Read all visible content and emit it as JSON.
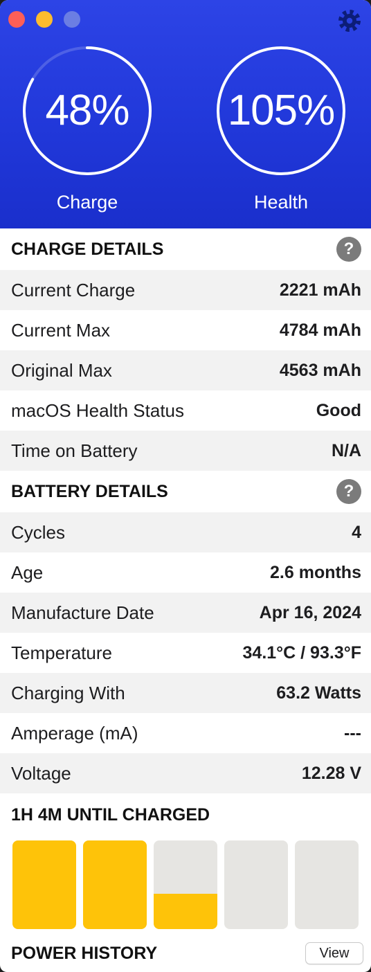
{
  "header": {
    "gauges": {
      "charge": {
        "value": "48%",
        "label": "Charge"
      },
      "health": {
        "value": "105%",
        "label": "Health"
      }
    }
  },
  "charge_details": {
    "heading": "CHARGE DETAILS",
    "help_label": "?",
    "rows": [
      {
        "label": "Current Charge",
        "value": "2221 mAh"
      },
      {
        "label": "Current Max",
        "value": "4784 mAh"
      },
      {
        "label": "Original Max",
        "value": "4563 mAh"
      },
      {
        "label": "macOS Health Status",
        "value": "Good"
      },
      {
        "label": "Time on Battery",
        "value": "N/A"
      }
    ]
  },
  "battery_details": {
    "heading": "BATTERY DETAILS",
    "help_label": "?",
    "rows": [
      {
        "label": "Cycles",
        "value": "4"
      },
      {
        "label": "Age",
        "value": "2.6 months"
      },
      {
        "label": "Manufacture Date",
        "value": "Apr 16, 2024"
      },
      {
        "label": "Temperature",
        "value": "34.1°C / 93.3°F"
      },
      {
        "label": "Charging With",
        "value": "63.2 Watts"
      },
      {
        "label": "Amperage (mA)",
        "value": "---"
      },
      {
        "label": "Voltage",
        "value": "12.28 V"
      }
    ]
  },
  "charging": {
    "heading": "1H 4M UNTIL CHARGED",
    "bar_levels": [
      1,
      1,
      0.4,
      0,
      0
    ]
  },
  "power_history": {
    "heading": "POWER HISTORY",
    "view_label": "View"
  },
  "icons": {
    "settings": "gear-icon",
    "help": "question-mark-icon",
    "window_close": "close-dot",
    "window_minimize": "minimize-dot",
    "window_zoom": "zoom-dot"
  },
  "colors": {
    "header_top": "#2d44e6",
    "header_bottom": "#1a2fcc",
    "bar_fill": "#fec309",
    "bar_empty": "#e6e5e2",
    "row_stripe": "#f2f2f2",
    "help_icon": "#7b7b7b",
    "gear": "#0c1d78"
  }
}
